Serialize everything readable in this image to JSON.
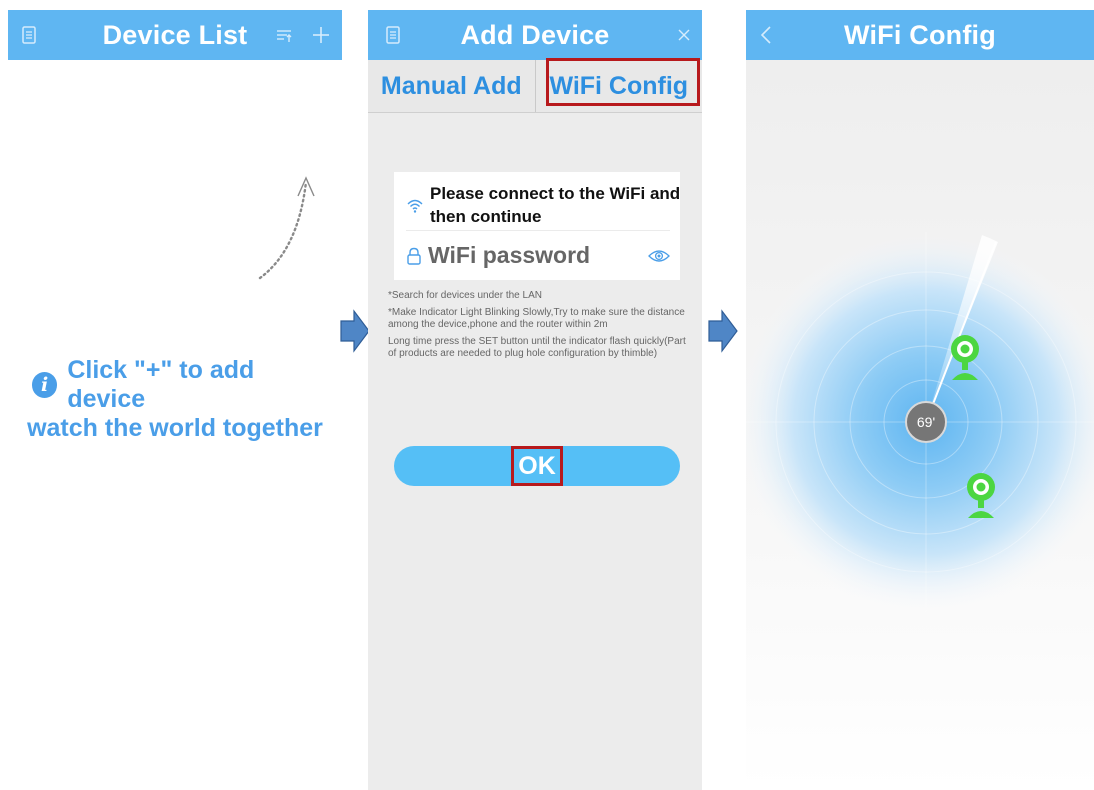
{
  "device_list": {
    "title": "Device List",
    "hint_line1": "Click \"+\" to add device",
    "hint_line2": "watch the world together"
  },
  "add_device": {
    "title": "Add Device",
    "tabs": [
      "Manual Add",
      "WiFi Config"
    ],
    "active_tab": "WiFi Config",
    "wifi_prompt": "Please connect to the WiFi and then continue",
    "password_placeholder": "WiFi password",
    "notes": [
      "*Search for devices under the LAN",
      "*Make Indicator Light Blinking Slowly,Try to make sure the distance among the device,phone and the router within 2m",
      "Long time press the SET button until the indicator flash quickly(Part of products are needed to plug hole configuration by thimble)"
    ],
    "ok_label": "OK"
  },
  "wifi_config": {
    "title": "WiFi Config",
    "angle": "69'"
  },
  "colors": {
    "header": "#5fb6f2",
    "accent_text": "#4a9ee8",
    "highlight_box": "#b7191c",
    "camera": "#4cd641",
    "flow_arrow": "#4f86c6"
  },
  "icons": [
    "document-icon",
    "sort-icon",
    "plus-icon",
    "close-icon",
    "back-icon",
    "wifi-icon",
    "lock-icon",
    "eye-icon",
    "info-icon",
    "camera-icon"
  ]
}
